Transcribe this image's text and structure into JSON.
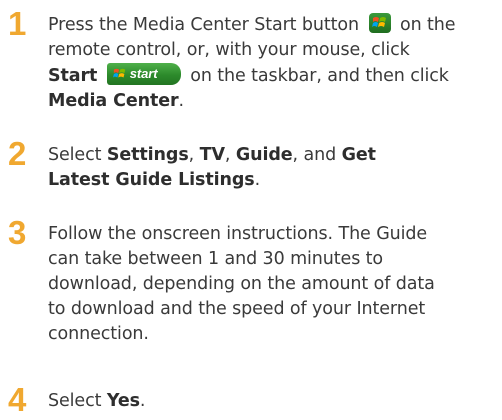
{
  "steps": [
    {
      "number": "1",
      "line1_a": "Press the Media Center Start button",
      "line1_b": "on the",
      "line2": "remote control, or, with your mouse, click",
      "line3_start": "Start",
      "line3_b": "on the taskbar, and then click",
      "line4_bold": "Media Center",
      "line4_end": "."
    },
    {
      "number": "2",
      "select": "Select",
      "settings": "Settings",
      "comma1": ",",
      "tv": "TV",
      "comma2": ",",
      "guide": "Guide",
      "and": ", and",
      "get": "Get",
      "line2_bold": "Latest Guide Listings",
      "line2_end": "."
    },
    {
      "number": "3",
      "lines": [
        "Follow the onscreen instructions. The Guide",
        "can take between 1 and 30 minutes to",
        "download, depending on the amount of data",
        "to download and the speed of your Internet",
        "connection."
      ]
    },
    {
      "number": "4",
      "select": "Select",
      "yes": "Yes",
      "end": "."
    }
  ],
  "taskbar_start_label": "start",
  "colors": {
    "step_number": "#f0a830",
    "text": "#3a3a3a",
    "start_green": "#2c8a2b"
  },
  "icons": {
    "media_center_start": "windows-flag-icon",
    "taskbar_start": "windows-start-button"
  }
}
